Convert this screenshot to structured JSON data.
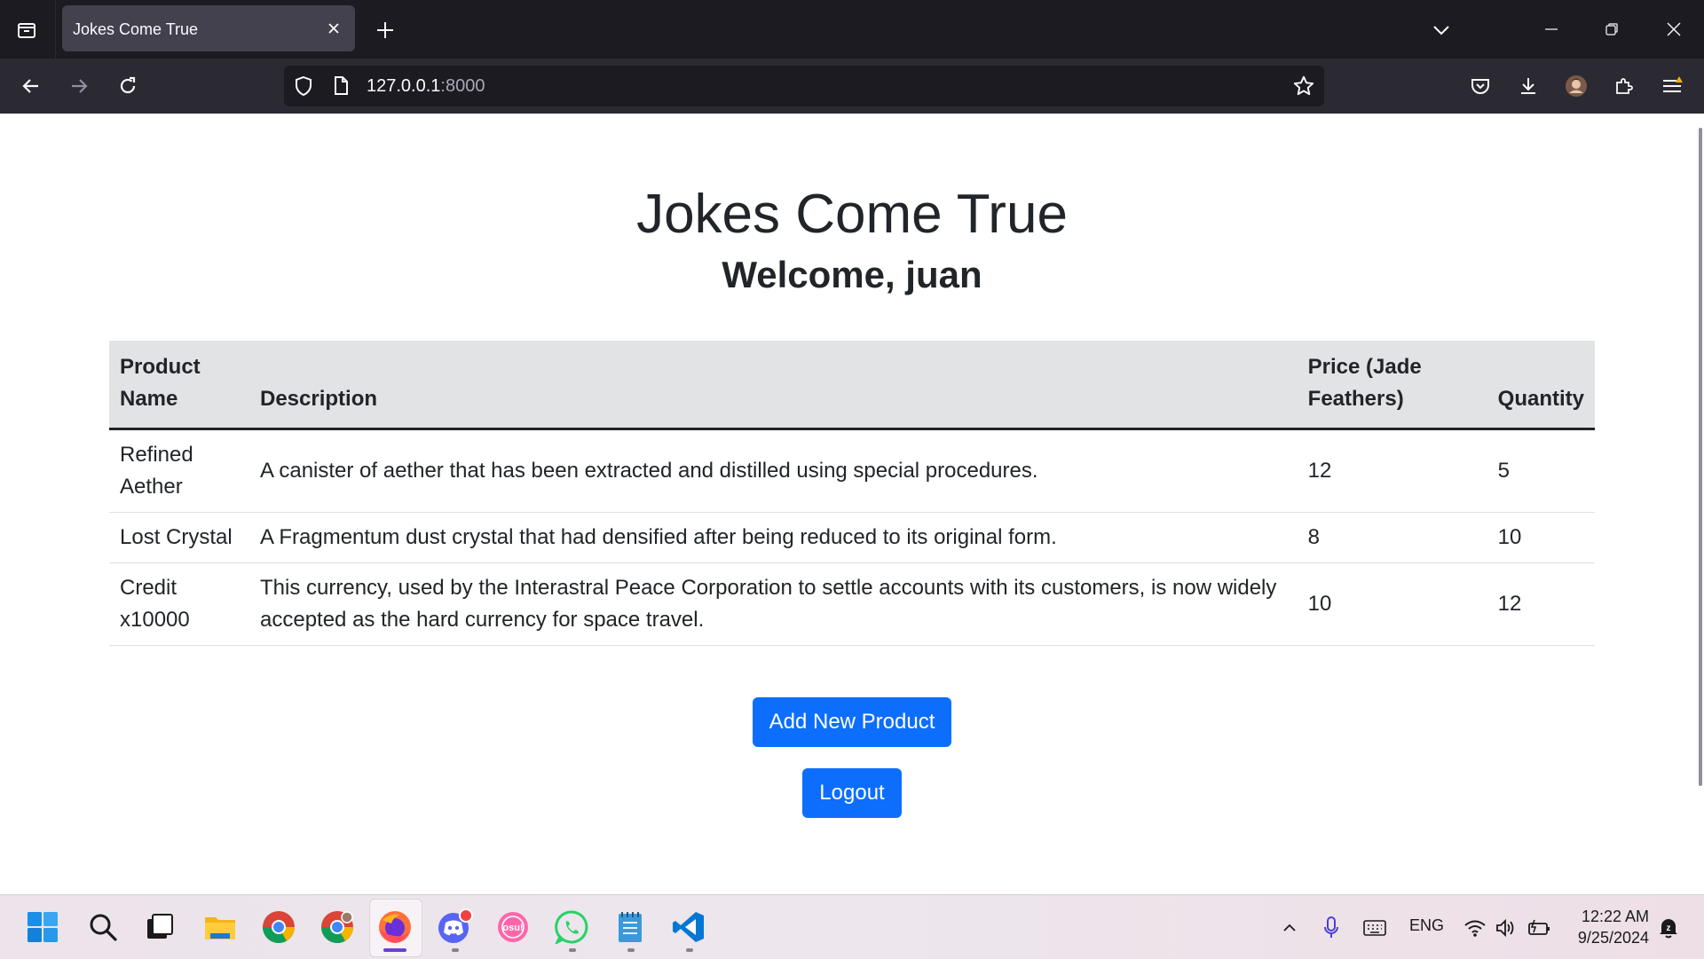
{
  "browser": {
    "tab": {
      "title": "Jokes Come True"
    },
    "url": {
      "host": "127.0.0.1",
      "port": ":8000"
    }
  },
  "page": {
    "title": "Jokes Come True",
    "welcome": "Welcome, juan",
    "table": {
      "headers": {
        "name": "Product Name",
        "description": "Description",
        "price": "Price (Jade Feathers)",
        "quantity": "Quantity"
      },
      "rows": [
        {
          "name": "Refined Aether",
          "description": "A canister of aether that has been extracted and distilled using special procedures.",
          "price": "12",
          "quantity": "5"
        },
        {
          "name": "Lost Crystal",
          "description": "A Fragmentum dust crystal that had densified after being reduced to its original form.",
          "price": "8",
          "quantity": "10"
        },
        {
          "name": "Credit x10000",
          "description": "This currency, used by the Interastral Peace Corporation to settle accounts with its customers, is now widely accepted as the hard currency for space travel.",
          "price": "10",
          "quantity": "12"
        }
      ]
    },
    "buttons": {
      "add": "Add New Product",
      "logout": "Logout"
    }
  },
  "taskbar": {
    "apps": [
      "windows-start-icon",
      "search-icon",
      "task-view-icon",
      "file-explorer-icon",
      "chrome-icon",
      "chrome-alt-icon",
      "firefox-icon",
      "discord-icon",
      "osu-icon",
      "whatsapp-icon",
      "notepad-icon",
      "vscode-icon"
    ],
    "tray": {
      "language": "ENG",
      "time": "12:22 AM",
      "date": "9/25/2024"
    }
  },
  "colors": {
    "primary": "#0d6efd",
    "table_header_bg": "#e2e3e5",
    "browser_dark": "#1c1b22"
  }
}
